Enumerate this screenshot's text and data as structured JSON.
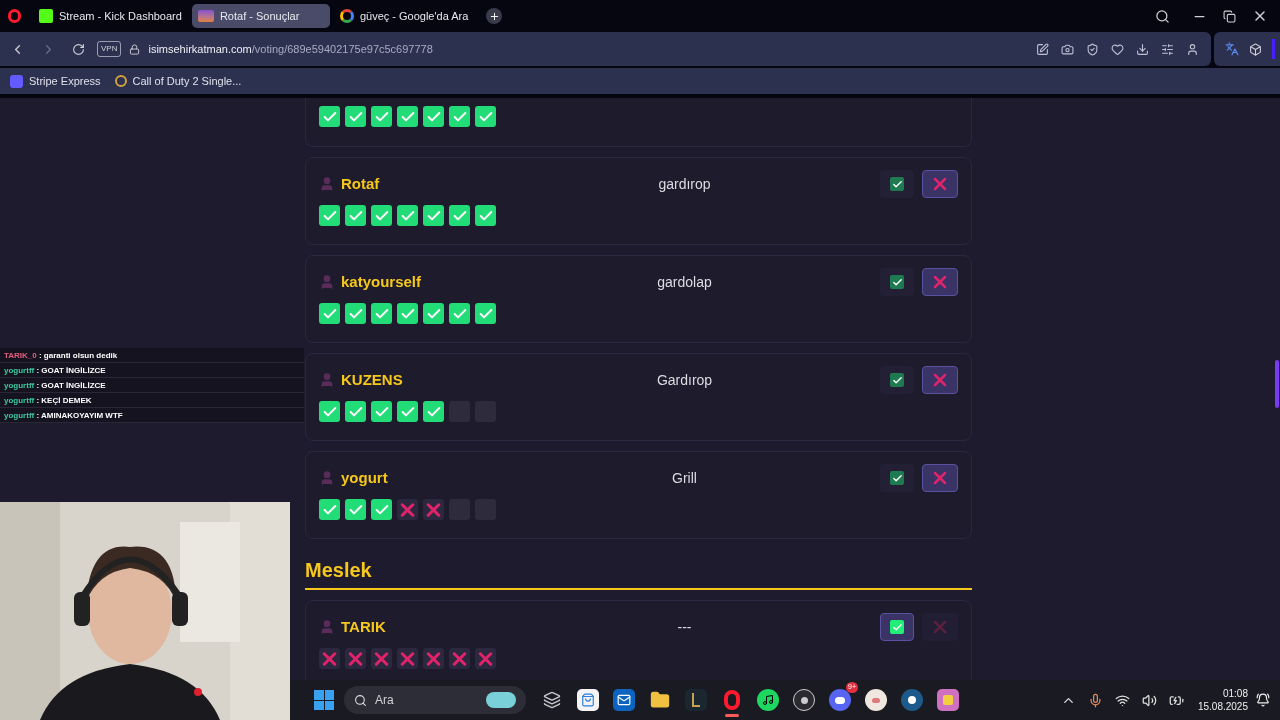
{
  "browser": {
    "tabs": [
      {
        "label": "Stream - Kick Dashboard",
        "kind": "kick",
        "selected": false
      },
      {
        "label": "Rotaf - Sonuçlar",
        "kind": "site",
        "selected": true
      },
      {
        "label": "güveç - Google'da Ara",
        "kind": "google",
        "selected": false
      }
    ],
    "vpn": "VPN",
    "url_host": "isimsehirkatman.com",
    "url_path": "/voting/689e59402175e97c5c697778",
    "bookmarks": [
      {
        "label": "Stripe Express",
        "kind": "stripe"
      },
      {
        "label": "Call of Duty 2 Single...",
        "kind": "cod"
      }
    ]
  },
  "page": {
    "sections": [
      {
        "answers": [
          {
            "votes": [
              {
                "kind": "yes"
              },
              {
                "kind": "yes"
              },
              {
                "kind": "yes"
              },
              {
                "kind": "yes"
              },
              {
                "kind": "yes"
              },
              {
                "kind": "yes"
              },
              {
                "kind": "yes"
              }
            ]
          },
          {
            "player": "Rotaf",
            "answer": "gardırop",
            "approved": false,
            "votes": [
              {
                "kind": "yes"
              },
              {
                "kind": "yes"
              },
              {
                "kind": "yes"
              },
              {
                "kind": "yes"
              },
              {
                "kind": "yes"
              },
              {
                "kind": "yes"
              },
              {
                "kind": "yes"
              }
            ]
          },
          {
            "player": "katyourself",
            "answer": "gardolap",
            "approved": false,
            "votes": [
              {
                "kind": "yes"
              },
              {
                "kind": "yes"
              },
              {
                "kind": "yes"
              },
              {
                "kind": "yes"
              },
              {
                "kind": "yes"
              },
              {
                "kind": "yes"
              },
              {
                "kind": "yes"
              }
            ]
          },
          {
            "player": "KUZENS",
            "answer": "Gardırop",
            "approved": false,
            "votes": [
              {
                "kind": "yes"
              },
              {
                "kind": "yes"
              },
              {
                "kind": "yes"
              },
              {
                "kind": "yes"
              },
              {
                "kind": "yes"
              },
              {
                "kind": "empty"
              },
              {
                "kind": "empty"
              }
            ]
          },
          {
            "player": "yogurt",
            "answer": "Grill",
            "approved": false,
            "votes": [
              {
                "kind": "yes"
              },
              {
                "kind": "yes"
              },
              {
                "kind": "yes"
              },
              {
                "kind": "no"
              },
              {
                "kind": "no"
              },
              {
                "kind": "empty"
              },
              {
                "kind": "empty"
              }
            ]
          }
        ]
      },
      {
        "heading": "Meslek",
        "answers": [
          {
            "player": "TARIK",
            "answer": "---",
            "approved": true,
            "votes": [
              {
                "kind": "no"
              },
              {
                "kind": "no"
              },
              {
                "kind": "no"
              },
              {
                "kind": "no"
              },
              {
                "kind": "no"
              },
              {
                "kind": "no"
              },
              {
                "kind": "no"
              }
            ]
          }
        ]
      }
    ]
  },
  "chat": [
    {
      "user": "TARIK_0",
      "color": "#e0607e",
      "message": ": garanti olsun dedik"
    },
    {
      "user": "yogurtff",
      "color": "#3cc8a0",
      "message": ": GOAT İNGİLİZCE"
    },
    {
      "user": "yogurtff",
      "color": "#3cc8a0",
      "message": ": GOAT İNGİLİZCE"
    },
    {
      "user": "yogurtff",
      "color": "#3cc8a0",
      "message": ": KEÇİ DEMEK"
    },
    {
      "user": "yogurtff",
      "color": "#3cc8a0",
      "message": ": AMINAKOYAYIM WTF"
    }
  ],
  "taskbar": {
    "search_placeholder": "Ara",
    "time": "01:08",
    "date": "15.08.2025",
    "discord_badge": "9+"
  }
}
